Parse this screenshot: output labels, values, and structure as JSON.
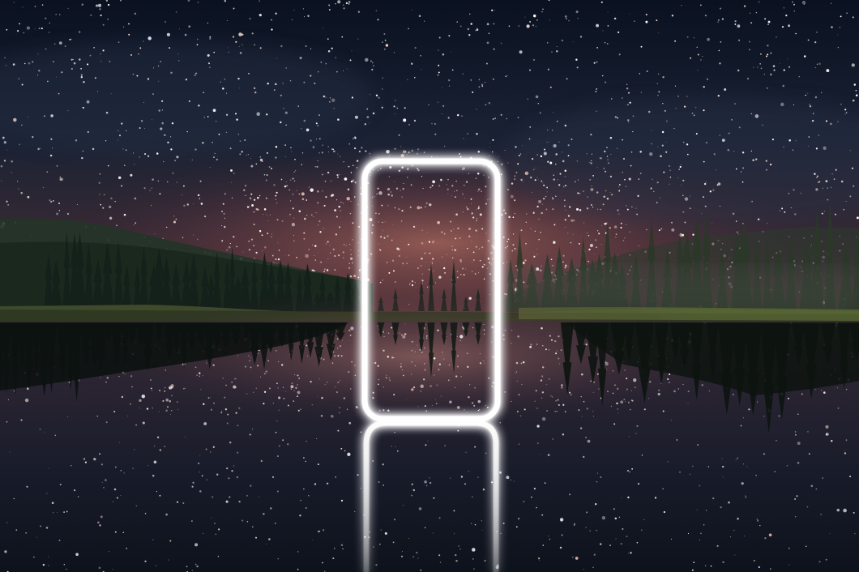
{
  "scene": {
    "description_elements": [
      "night-sky",
      "forest-treeline",
      "lake-reflection",
      "glowing-frame"
    ],
    "colors": {
      "sky_top": "#0b1222",
      "sky_mid": "#1c2436",
      "horizon_glow": "#8a4a4a",
      "forest": "#1d2e22",
      "grass": "#4b5a30",
      "water": "#141824",
      "frame_glow": "#ffffff"
    }
  }
}
